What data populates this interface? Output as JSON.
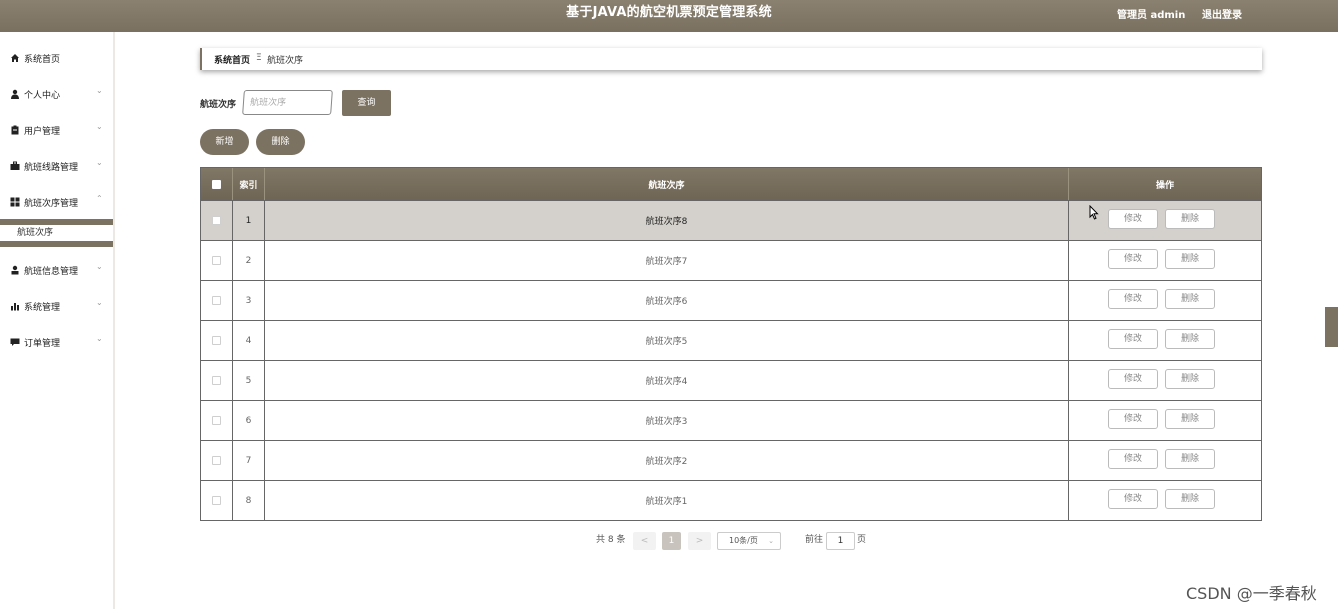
{
  "header": {
    "title": "基于JAVA的航空机票预定管理系统",
    "user": "管理员 admin",
    "logout": "退出登录"
  },
  "sidebar": {
    "items": [
      {
        "label": "系统首页",
        "icon": "home-icon"
      },
      {
        "label": "个人中心",
        "icon": "user-icon"
      },
      {
        "label": "用户管理",
        "icon": "clipboard-icon"
      },
      {
        "label": "航班线路管理",
        "icon": "briefcase-icon"
      },
      {
        "label": "航班次序管理",
        "icon": "grid-icon"
      },
      {
        "label": "航班信息管理",
        "icon": "person-icon"
      },
      {
        "label": "系统管理",
        "icon": "bar-chart-icon"
      },
      {
        "label": "订单管理",
        "icon": "message-icon"
      }
    ],
    "submenu_item": "航班次序"
  },
  "breadcrumb": {
    "home": "系统首页",
    "separator": "Ξ",
    "current": "航班次序"
  },
  "search": {
    "label": "航班次序",
    "placeholder": "航班次序",
    "button": "查询"
  },
  "actions": {
    "add": "新增",
    "delete": "删除"
  },
  "table": {
    "headers": {
      "index": "索引",
      "name": "航班次序",
      "ops": "操作"
    },
    "rows": [
      {
        "index": "1",
        "name": "航班次序8"
      },
      {
        "index": "2",
        "name": "航班次序7"
      },
      {
        "index": "3",
        "name": "航班次序6"
      },
      {
        "index": "4",
        "name": "航班次序5"
      },
      {
        "index": "5",
        "name": "航班次序4"
      },
      {
        "index": "6",
        "name": "航班次序3"
      },
      {
        "index": "7",
        "name": "航班次序2"
      },
      {
        "index": "8",
        "name": "航班次序1"
      }
    ],
    "edit_label": "修改",
    "delete_label": "删除",
    "selected_row": 1
  },
  "pagination": {
    "total": "共 8 条",
    "prev": "<",
    "page": "1",
    "next": ">",
    "page_size": "10条/页",
    "goto_label": "前往",
    "goto_value": "1",
    "page_suffix": "页"
  },
  "watermark": "CSDN @一季春秋",
  "colors": {
    "accent": "#7c7262",
    "header": "#7a705f"
  }
}
